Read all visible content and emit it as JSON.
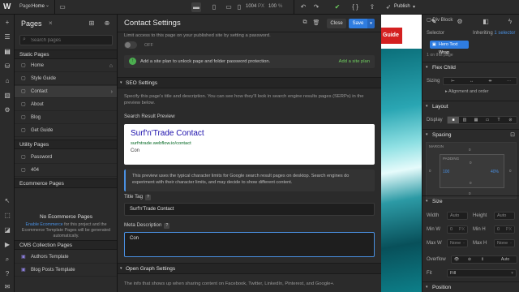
{
  "topbar": {
    "logo": "W",
    "page_label": "Page:",
    "page_name": "Home",
    "page_chevron": "⌄",
    "dimensions": "1004",
    "dimensions_unit": "PX",
    "zoom": "100",
    "zoom_unit": "%",
    "publish": "Publish",
    "publish_caret": "▾"
  },
  "pages_panel": {
    "title": "Pages",
    "close": "×",
    "search_placeholder": "Search pages",
    "static_header": "Static Pages",
    "static_pages": [
      {
        "label": "Home",
        "icon": "home-icon",
        "glyph": "⌂"
      },
      {
        "label": "Style Guide"
      },
      {
        "label": "Contact",
        "selected": true,
        "chevron": "›"
      },
      {
        "label": "About"
      },
      {
        "label": "Blog"
      },
      {
        "label": "Get Guide"
      }
    ],
    "utility_header": "Utility Pages",
    "utility_pages": [
      {
        "label": "Password"
      },
      {
        "label": "404"
      }
    ],
    "ecommerce_header": "Ecommerce Pages",
    "ecommerce_empty_title": "No Ecommerce Pages",
    "ecommerce_link": "Enable Ecommerce",
    "ecommerce_empty_desc": " for this project and the Ecommerce Template Pages will be generated automatically.",
    "cms_header": "CMS Collection Pages",
    "cms_pages": [
      {
        "label": "Authors Template"
      },
      {
        "label": "Blog Posts Template"
      }
    ]
  },
  "settings_panel": {
    "title": "Contact Settings",
    "close_label": "Close",
    "save_label": "Save",
    "save_caret": "▾",
    "password_desc": "Limit access to this page on your published site by setting a password.",
    "toggle_label": "OFF",
    "plan_msg": "Add a site plan to unlock page and folder password protection.",
    "plan_link": "Add a site plan",
    "seo_header": "SEO Settings",
    "section_chevron": "▾",
    "seo_desc": "Specify this page's title and description. You can see how they'll look in search engine results pages (SERPs) in the preview below.",
    "preview_label": "Search Result Preview",
    "preview": {
      "title": "Surf'n'Trade Contact",
      "url": "surfntrade.webflow.io/contact",
      "desc": "Con"
    },
    "preview_info": "This preview uses the typical character limits for Google search result pages on desktop. Search engines do experiment with their character limits, and may decide to show different content.",
    "title_tag_label": "Title Tag",
    "help_mark": "?",
    "title_tag_value": "Surf'n'Trade Contact",
    "meta_desc_label": "Meta Description",
    "meta_desc_value": "Con",
    "og_header": "Open Graph Settings",
    "og_desc": "The info that shows up when sharing content on Facebook, Twitter, LinkedIn, Pinterest, and Google+."
  },
  "canvas": {
    "guide_label": "Guide"
  },
  "style_panel": {
    "element": "Div Block",
    "selector_label": "Selector",
    "inheriting": "Inheriting",
    "inheriting_count": "1 selector",
    "class_chip": "Hero Text Wrap",
    "on_page": "1 on this page",
    "flex_child": "Flex Child",
    "sizing_label": "Sizing",
    "alignment": "Alignment and order",
    "layout": "Layout",
    "display_label": "Display",
    "spacing": "Spacing",
    "margin_label": "MARGIN",
    "padding_label": "PADDING",
    "pad_left": "100",
    "pad_right": "40%",
    "size": "Size",
    "width_label": "Width",
    "height_label": "Height",
    "min_w_label": "Min W",
    "min_h_label": "Min H",
    "max_w_label": "Max W",
    "max_h_label": "Max H",
    "auto": "Auto",
    "px": "PX",
    "none": "None",
    "minus": "-",
    "zero": "0",
    "overflow_label": "Overflow",
    "overflow_auto": "Auto",
    "fit_label": "Fit",
    "fit_value": "Fill",
    "position": "Position",
    "chevron": "▾",
    "plus": "+"
  },
  "colors": {
    "accent": "#2f7de1",
    "canvas_red": "#d42020",
    "success": "#6fcf5f"
  }
}
